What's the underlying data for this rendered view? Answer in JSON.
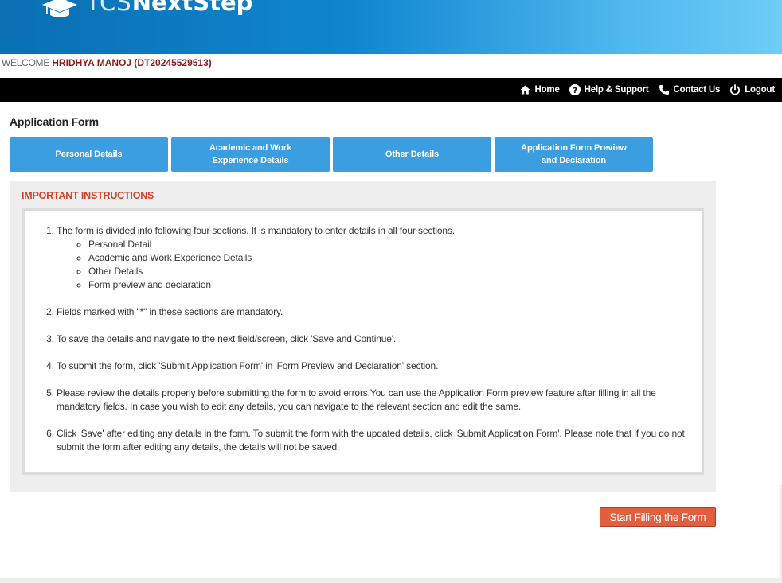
{
  "brand": {
    "prefix": "TCS",
    "suffix": "NextStep"
  },
  "welcome": {
    "label": "WELCOME",
    "user": "HRIDHYA MANOJ (DT20245529513)"
  },
  "nav": {
    "items": [
      {
        "label": "Home",
        "icon": "home-icon"
      },
      {
        "label": "Help & Support",
        "icon": "help-icon"
      },
      {
        "label": "Contact Us",
        "icon": "phone-icon"
      },
      {
        "label": "Logout",
        "icon": "power-icon"
      }
    ]
  },
  "page": {
    "title": "Application Form"
  },
  "tabs": [
    {
      "label": "Personal Details"
    },
    {
      "label": "Academic and Work\nExperience Details"
    },
    {
      "label": "Other Details"
    },
    {
      "label": "Application Form Preview\nand Declaration"
    }
  ],
  "instructions": {
    "title": "IMPORTANT INSTRUCTIONS",
    "items": [
      {
        "text": "The form is divided into following four sections. It is mandatory to enter details in all four sections."
      },
      {
        "text": "Fields marked with \"*\" in these sections are mandatory."
      },
      {
        "text": "To save the details and navigate to the next field/screen, click 'Save and Continue'."
      },
      {
        "text": "To submit the form, click 'Submit Application Form' in 'Form Preview and Declaration' section."
      },
      {
        "text": "Please review the details properly before submitting the form to avoid errors.You can use the Application Form preview feature after filling in all the mandatory fields. In case you wish to edit any details, you can navigate to the relevant section and edit the same."
      },
      {
        "text": "Click 'Save' after editing any details in the form. To submit the form with the updated details, click 'Submit Application Form'. Please note that if you do not submit the form after editing any details, the details will not be saved."
      }
    ],
    "sections": [
      "Personal Detail",
      "Academic and Work Experience Details",
      "Other Details",
      "Form preview and declaration"
    ]
  },
  "actions": {
    "start_label": "Start Filling the Form"
  },
  "colors": {
    "tab": "#3a9ee0",
    "alert": "#d3402b",
    "start_button": "#e15e3f",
    "welcome_name": "#8b1c1c"
  }
}
